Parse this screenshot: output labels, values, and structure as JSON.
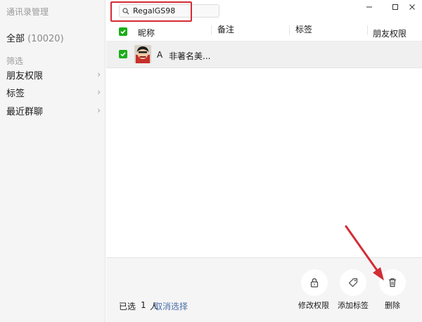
{
  "sidebar": {
    "title": "通讯录管理",
    "all_label": "全部",
    "all_count": "(10020)",
    "filter_heading": "筛选",
    "items": [
      {
        "label": "朋友权限"
      },
      {
        "label": "标签"
      },
      {
        "label": "最近群聊"
      }
    ]
  },
  "search": {
    "value": "RegalGS98"
  },
  "table": {
    "headers": {
      "nickname": "昵称",
      "remark": "备注",
      "tag": "标签",
      "permission": "朋友权限"
    },
    "rows": [
      {
        "letter": "A",
        "name": "非著名美..."
      }
    ]
  },
  "footer": {
    "selected_prefix": "已选",
    "selected_count": "1",
    "selected_unit": "人",
    "deselect": "取消选择",
    "actions": {
      "modify_permission": "修改权限",
      "add_tag": "添加标签",
      "delete": "删除"
    }
  },
  "colors": {
    "accent_green": "#1aad19",
    "link_blue": "#4a6ea9",
    "annotation_red": "#d32c34"
  }
}
